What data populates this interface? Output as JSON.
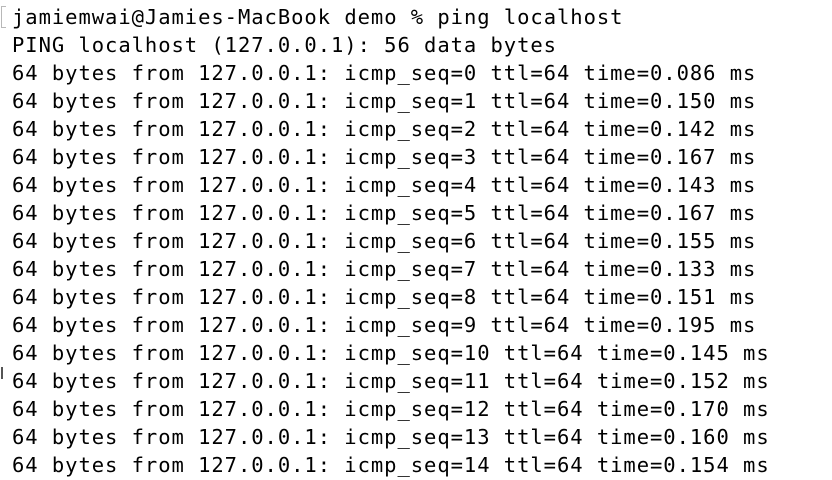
{
  "terminal": {
    "prompt": {
      "user_host": "jamiemwai@Jamies-MacBook",
      "directory": "demo",
      "symbol": "%",
      "command": "ping localhost"
    },
    "header": "PING localhost (127.0.0.1): 56 data bytes",
    "replies": [
      "64 bytes from 127.0.0.1: icmp_seq=0 ttl=64 time=0.086 ms",
      "64 bytes from 127.0.0.1: icmp_seq=1 ttl=64 time=0.150 ms",
      "64 bytes from 127.0.0.1: icmp_seq=2 ttl=64 time=0.142 ms",
      "64 bytes from 127.0.0.1: icmp_seq=3 ttl=64 time=0.167 ms",
      "64 bytes from 127.0.0.1: icmp_seq=4 ttl=64 time=0.143 ms",
      "64 bytes from 127.0.0.1: icmp_seq=5 ttl=64 time=0.167 ms",
      "64 bytes from 127.0.0.1: icmp_seq=6 ttl=64 time=0.155 ms",
      "64 bytes from 127.0.0.1: icmp_seq=7 ttl=64 time=0.133 ms",
      "64 bytes from 127.0.0.1: icmp_seq=8 ttl=64 time=0.151 ms",
      "64 bytes from 127.0.0.1: icmp_seq=9 ttl=64 time=0.195 ms",
      "64 bytes from 127.0.0.1: icmp_seq=10 ttl=64 time=0.145 ms",
      "64 bytes from 127.0.0.1: icmp_seq=11 ttl=64 time=0.152 ms",
      "64 bytes from 127.0.0.1: icmp_seq=12 ttl=64 time=0.170 ms",
      "64 bytes from 127.0.0.1: icmp_seq=13 ttl=64 time=0.160 ms",
      "64 bytes from 127.0.0.1: icmp_seq=14 ttl=64 time=0.154 ms"
    ],
    "colors": {
      "background": "#ffffff",
      "text": "#000000"
    }
  }
}
